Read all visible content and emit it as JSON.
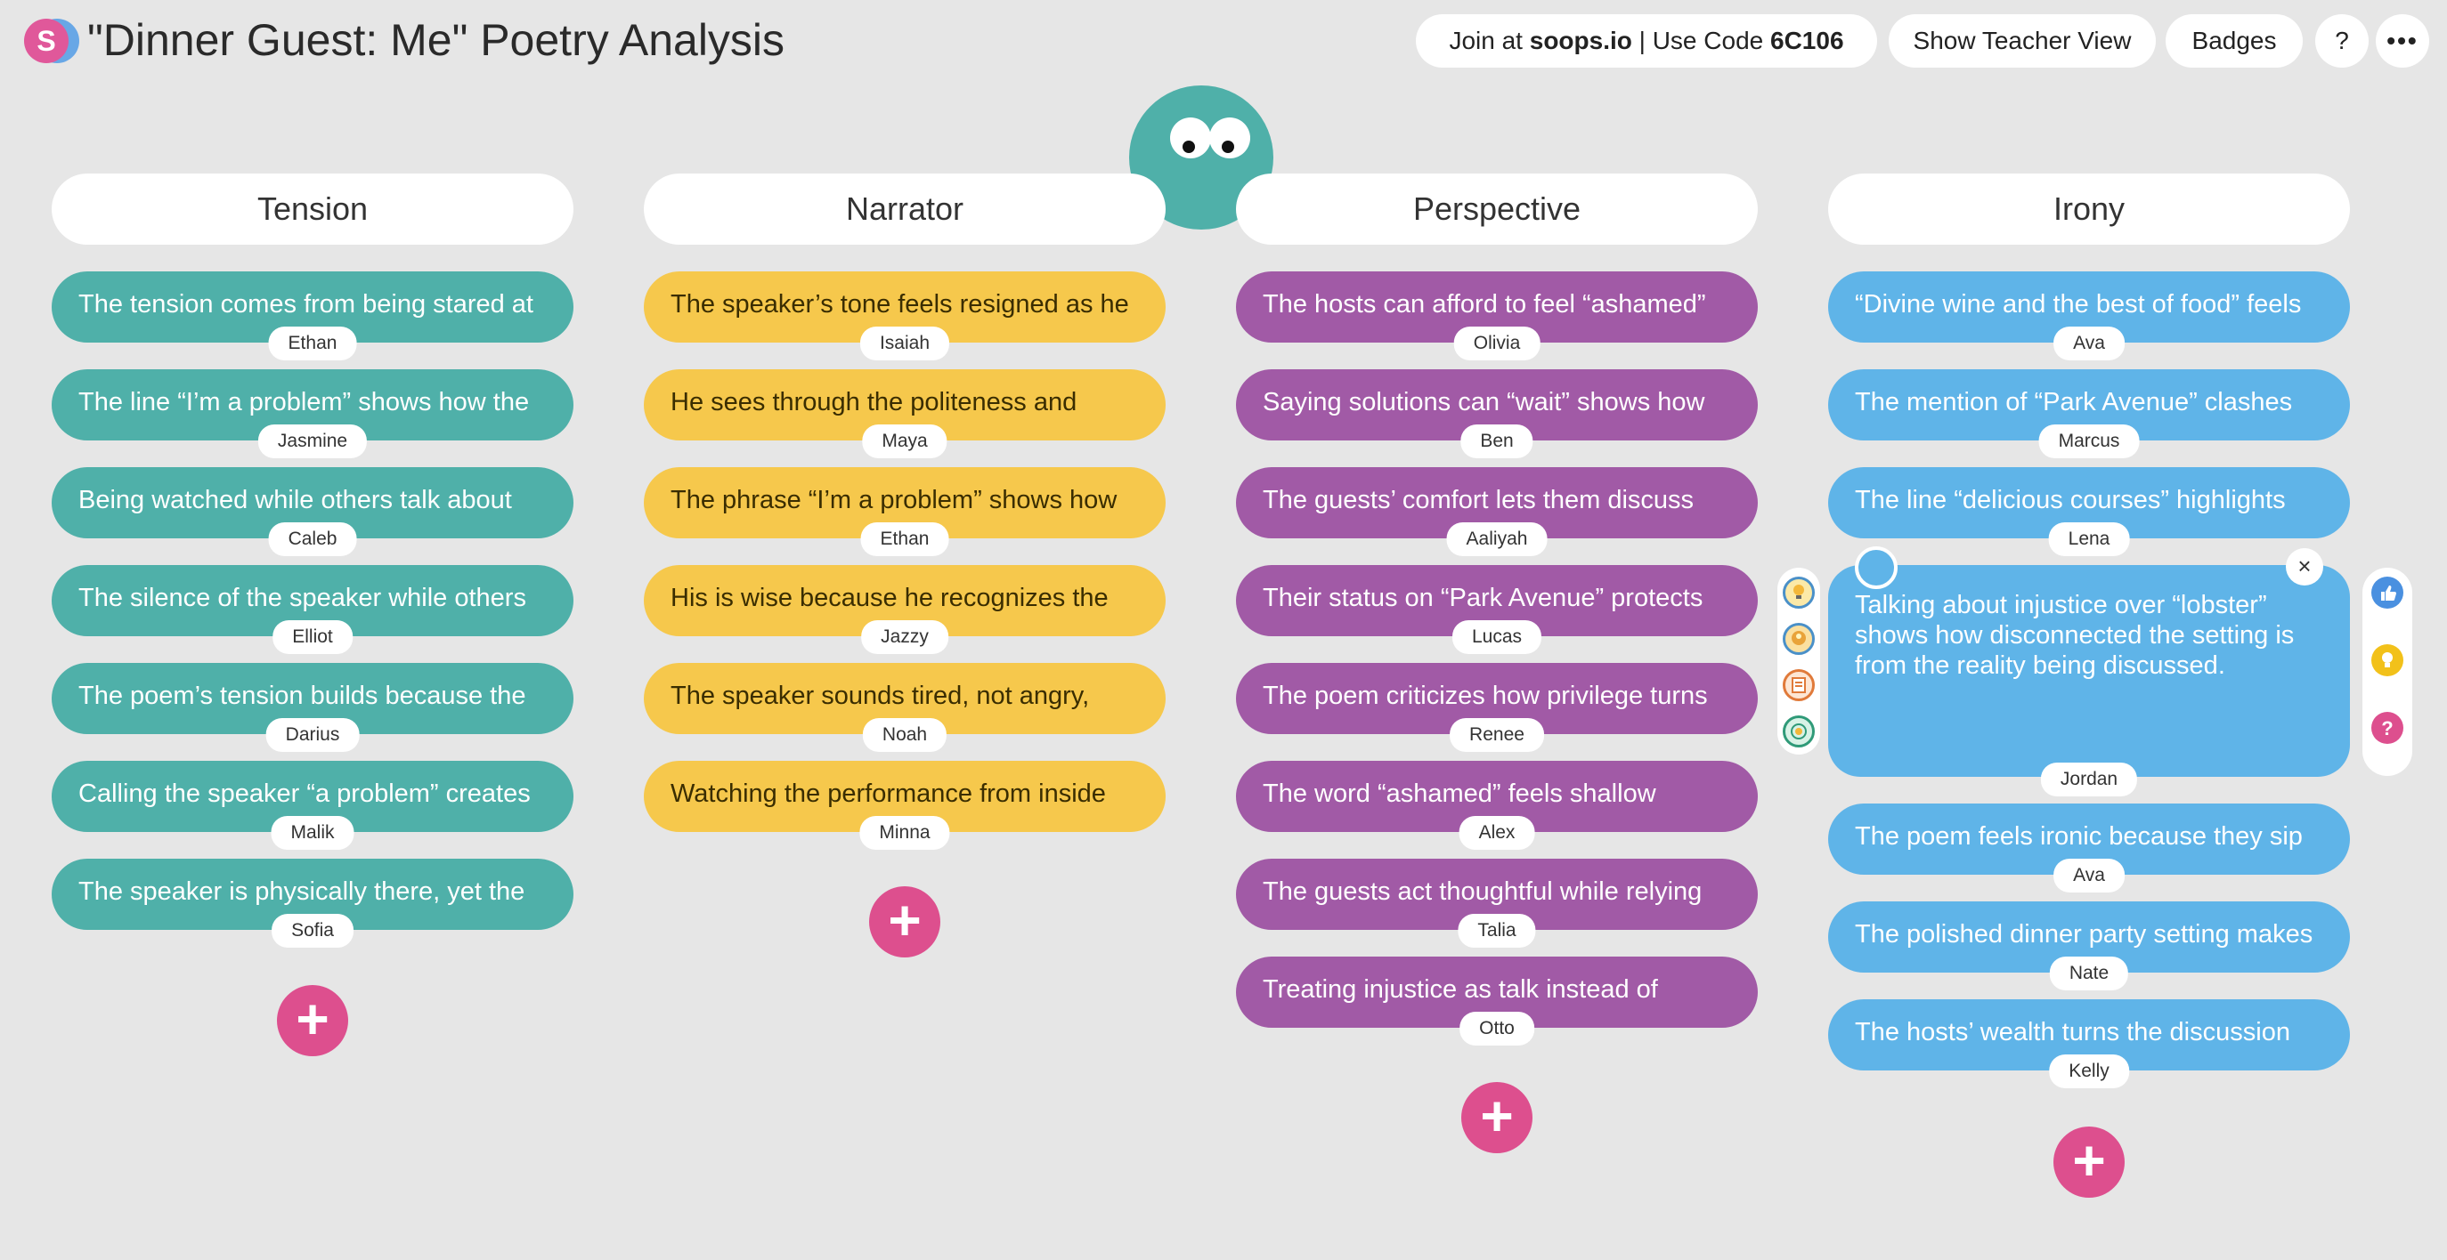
{
  "header": {
    "title": "\"Dinner Guest: Me\" Poetry Analysis",
    "logo_letter": "S",
    "join_prefix": "Join at ",
    "join_site": "soops.io",
    "join_mid": " | Use Code ",
    "join_code": "6C106",
    "teacher_view": "Show Teacher View",
    "badges": "Badges",
    "help": "?",
    "more": "•••"
  },
  "colors": {
    "tension": "#4fb0a9",
    "narrator": "#f6c84c",
    "perspective": "#a15aa6",
    "irony": "#5fb4e8",
    "add": "#dd4f8e"
  },
  "columns": [
    {
      "title": "Tension",
      "cards": [
        {
          "text": "The tension comes from being stared at",
          "author": "Ethan"
        },
        {
          "text": "The line “I’m a problem” shows how the",
          "author": "Jasmine"
        },
        {
          "text": "Being watched while others talk about",
          "author": "Caleb"
        },
        {
          "text": "The silence of the speaker while others",
          "author": "Elliot"
        },
        {
          "text": "The poem’s tension builds because the",
          "author": "Darius"
        },
        {
          "text": "Calling the speaker “a problem” creates",
          "author": "Malik"
        },
        {
          "text": "The speaker is physically there, yet the",
          "author": "Sofia"
        }
      ]
    },
    {
      "title": "Narrator",
      "cards": [
        {
          "text": "The speaker’s tone feels resigned as he",
          "author": "Isaiah"
        },
        {
          "text": "He sees through the politeness and",
          "author": "Maya"
        },
        {
          "text": "The phrase “I’m a problem” shows how",
          "author": "Ethan"
        },
        {
          "text": "His is wise because he recognizes the",
          "author": "Jazzy"
        },
        {
          "text": "The speaker sounds tired, not angry,",
          "author": "Noah"
        },
        {
          "text": "Watching the performance from inside",
          "author": "Minna"
        }
      ]
    },
    {
      "title": "Perspective",
      "cards": [
        {
          "text": "The hosts can afford to feel “ashamed”",
          "author": "Olivia"
        },
        {
          "text": "Saying solutions can “wait” shows how",
          "author": "Ben"
        },
        {
          "text": "The guests’ comfort lets them discuss",
          "author": "Aaliyah"
        },
        {
          "text": "Their status on “Park Avenue” protects",
          "author": "Lucas"
        },
        {
          "text": "The poem criticizes how privilege turns",
          "author": "Renee"
        },
        {
          "text": "The word “ashamed” feels shallow",
          "author": "Alex"
        },
        {
          "text": "The guests act thoughtful while relying",
          "author": "Talia"
        },
        {
          "text": "Treating injustice as talk instead of",
          "author": "Otto"
        }
      ]
    },
    {
      "title": "Irony",
      "cards": [
        {
          "text": "“Divine wine and the best of food” feels",
          "author": "Ava"
        },
        {
          "text": "The mention of “Park Avenue” clashes",
          "author": "Marcus"
        },
        {
          "text": "The line “delicious courses” highlights",
          "author": "Lena"
        },
        {
          "text": "Talking about injustice over “lobster” shows how disconnected the setting is from the reality being discussed.",
          "author": "Jordan"
        },
        {
          "text": "The poem feels ironic because they sip",
          "author": "Ava"
        },
        {
          "text": "The polished dinner party setting makes",
          "author": "Nate"
        },
        {
          "text": "The hosts’ wealth turns the discussion",
          "author": "Kelly"
        }
      ]
    }
  ],
  "add_label": "+",
  "close_label": "×",
  "reaction_icons": [
    "thumbs-up-icon",
    "lightbulb-icon",
    "question-icon"
  ],
  "tool_icons": [
    "lightbulb-icon",
    "idea-head-icon",
    "document-icon",
    "target-icon"
  ]
}
